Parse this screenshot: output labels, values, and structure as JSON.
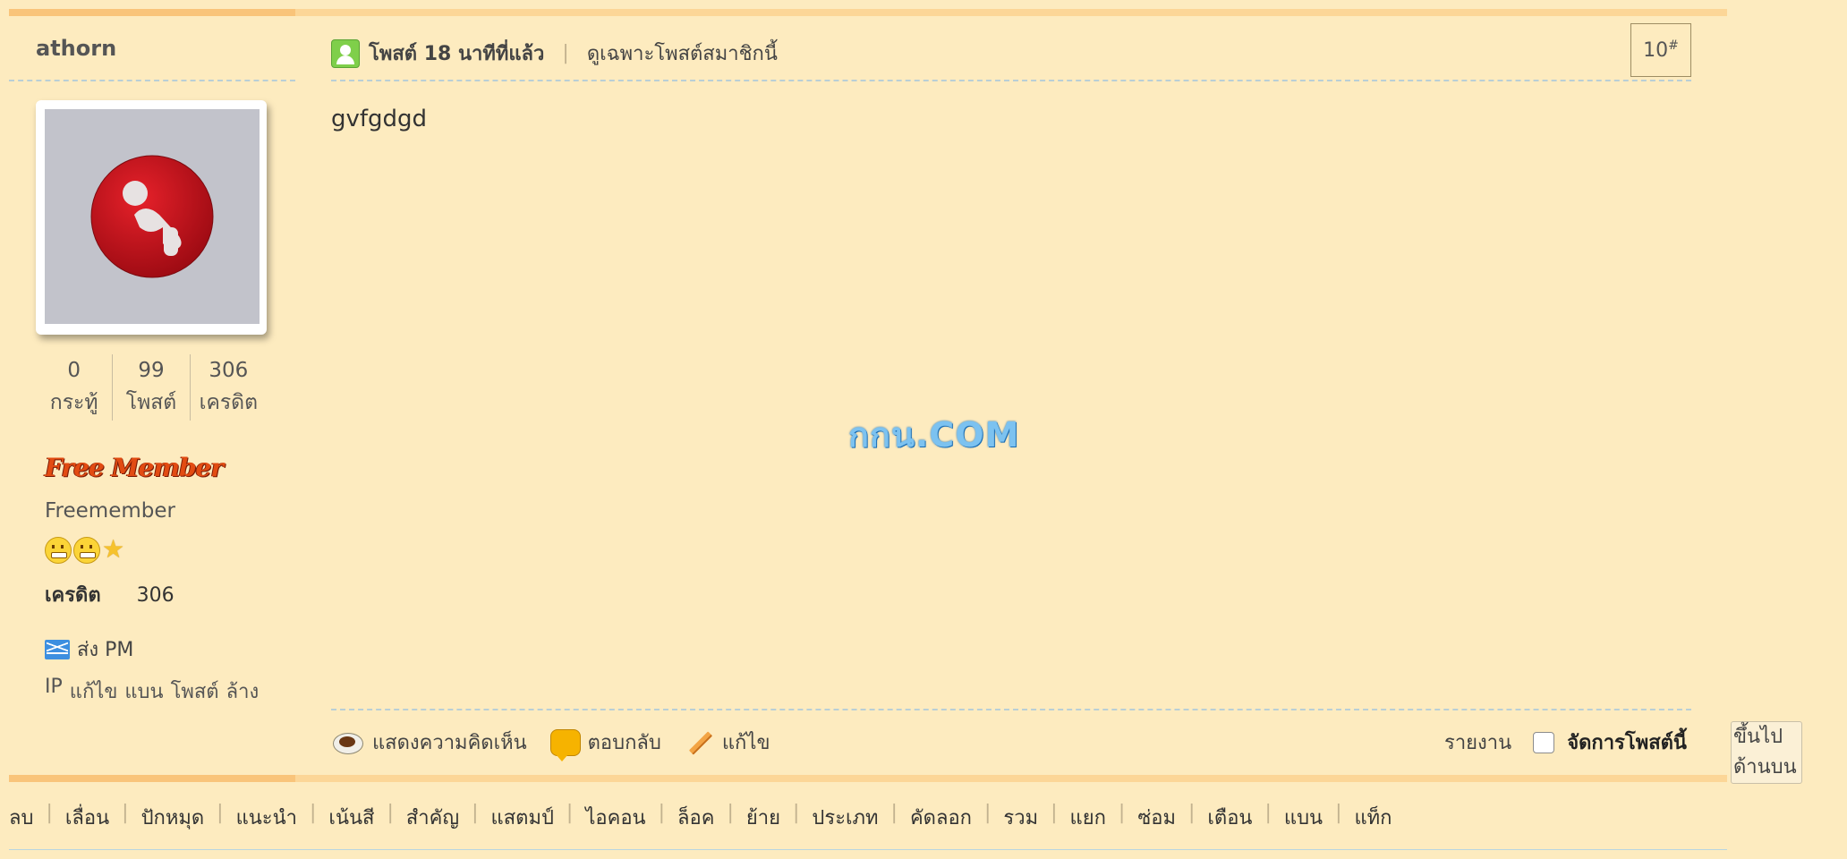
{
  "user": {
    "name": "athorn",
    "stats": [
      {
        "value": "0",
        "label": "กระทู้"
      },
      {
        "value": "99",
        "label": "โพสต์"
      },
      {
        "value": "306",
        "label": "เครดิต"
      }
    ],
    "group_badge": "Free Member",
    "group_name": "Freemember",
    "credit_label": "เครดิต",
    "credit_value": "306",
    "pm_label": "ส่ง PM",
    "admin_links": [
      "IP",
      "แก้ไข",
      "แบน",
      "โพสต์",
      "ล้าง"
    ]
  },
  "post": {
    "time": "โพสต์ 18 นาทีที่แล้ว",
    "only_author": "ดูเฉพาะโพสต์สมาชิกนี้",
    "number": "10",
    "number_suffix": "#",
    "body": "gvfgdgd",
    "watermark": "กกน.COM"
  },
  "actions": {
    "comment": "แสดงความคิดเห็น",
    "reply": "ตอบกลับ",
    "edit": "แก้ไข",
    "report": "รายงาน",
    "manage": "จัดการโพสต์นี้",
    "to_top_line1": "ขึ้นไป",
    "to_top_line2": "ด้านบน"
  },
  "mod_links": [
    "ลบ",
    "เลื่อน",
    "ปักหมุด",
    "แนะนำ",
    "เน้นสี",
    "สำคัญ",
    "แสตมป์",
    "ไอคอน",
    "ล็อค",
    "ย้าย",
    "ประเภท",
    "คัดลอก",
    "รวม",
    "แยก",
    "ซ่อม",
    "เตือน",
    "แบน",
    "แท็ก"
  ]
}
